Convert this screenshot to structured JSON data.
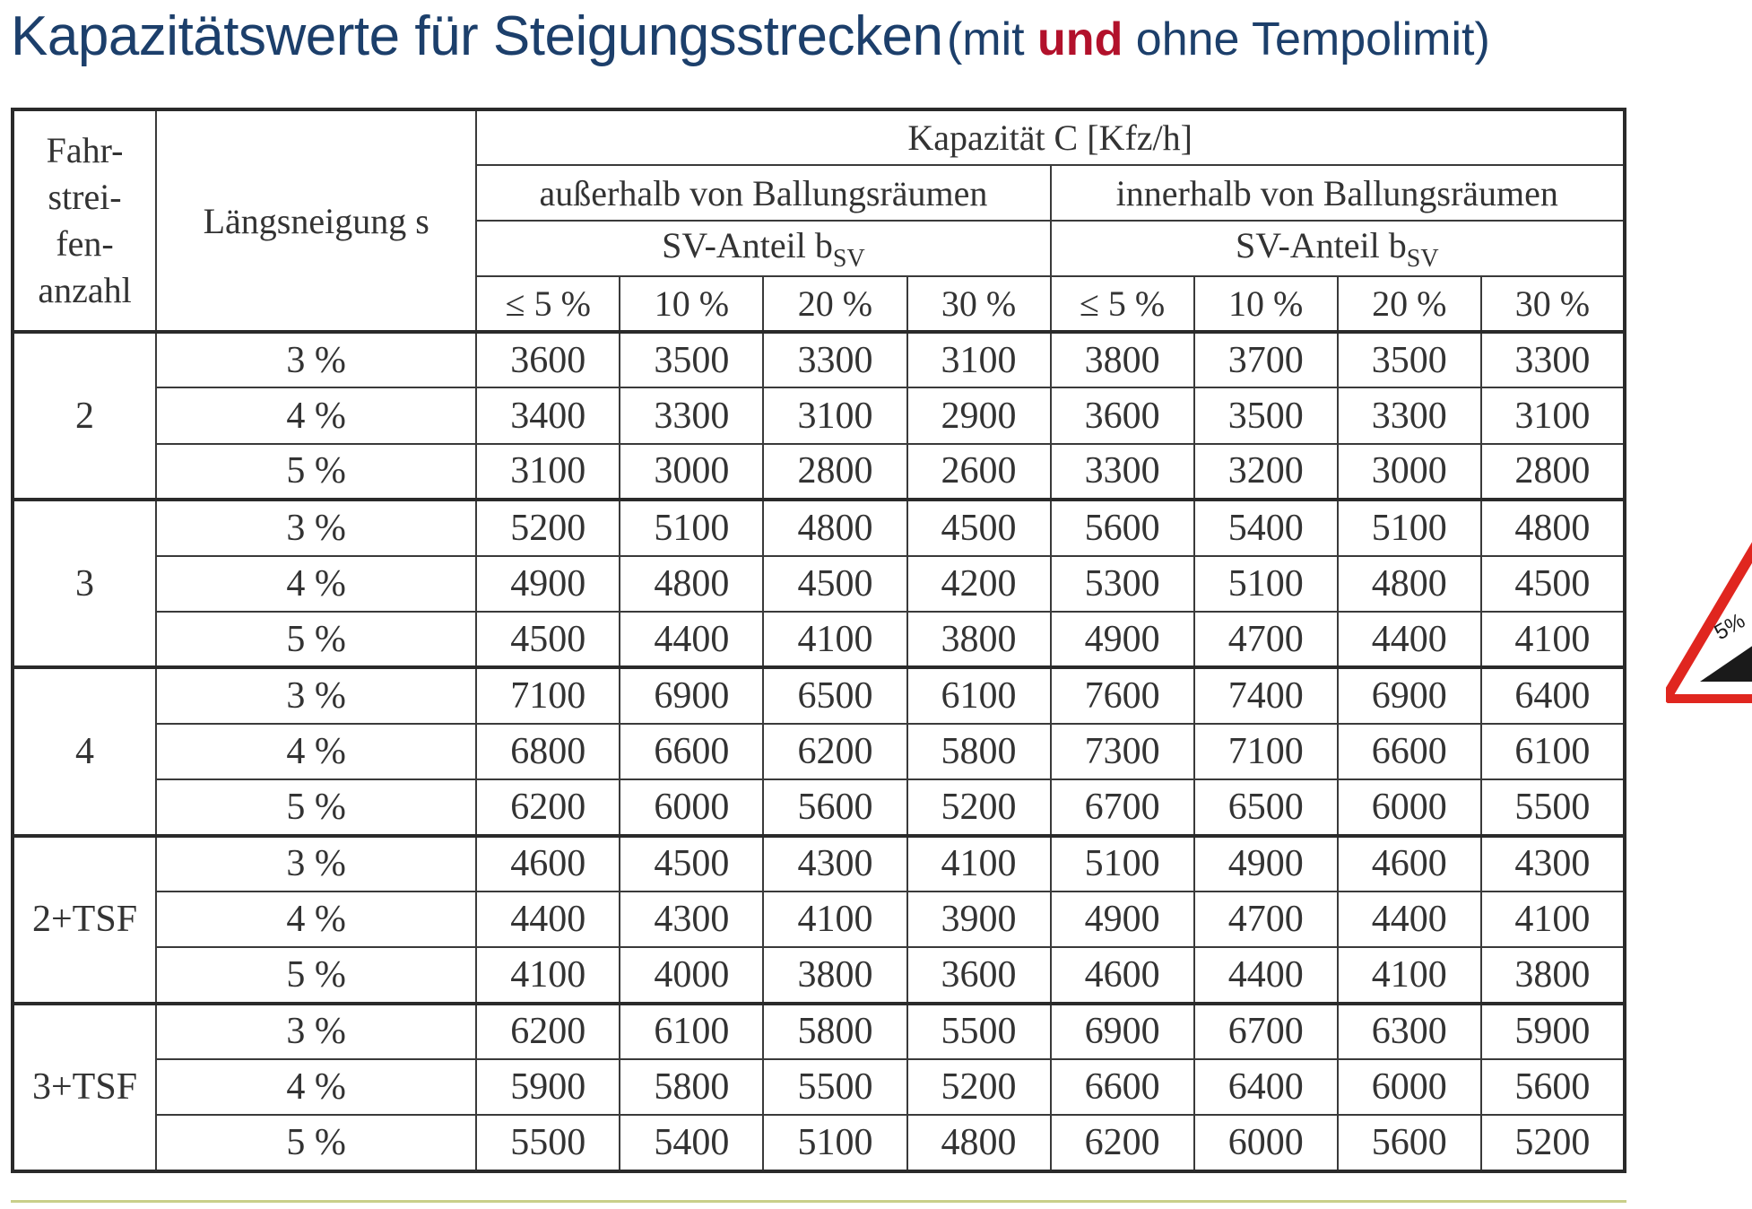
{
  "title": {
    "main": "Kapazitätswerte für Steigungsstrecken",
    "paren_open": "(mit ",
    "paren_accent": "und",
    "paren_rest": " ohne Tempolimit)",
    "color": "#1c3f6b",
    "accent_color": "#b2112b"
  },
  "table": {
    "header": {
      "lanes_label_lines": [
        "Fahr-",
        "strei-",
        "fen-",
        "anzahl"
      ],
      "slope_label": "Längsneigung s",
      "capacity_label": "Kapazität C [Kfz/h]",
      "groups": [
        "außerhalb von Ballungsräumen",
        "innerhalb von Ballungsräumen"
      ],
      "sv_label": "SV-Anteil b",
      "sv_subscript": "SV",
      "sv_columns": [
        "≤ 5 %",
        "10 %",
        "20 %",
        "30 %"
      ]
    },
    "groups": [
      {
        "lanes": "2",
        "rows": [
          {
            "slope": "3 %",
            "values": [
              "3600",
              "3500",
              "3300",
              "3100",
              "3800",
              "3700",
              "3500",
              "3300"
            ]
          },
          {
            "slope": "4 %",
            "values": [
              "3400",
              "3300",
              "3100",
              "2900",
              "3600",
              "3500",
              "3300",
              "3100"
            ]
          },
          {
            "slope": "5 %",
            "values": [
              "3100",
              "3000",
              "2800",
              "2600",
              "3300",
              "3200",
              "3000",
              "2800"
            ]
          }
        ]
      },
      {
        "lanes": "3",
        "rows": [
          {
            "slope": "3 %",
            "values": [
              "5200",
              "5100",
              "4800",
              "4500",
              "5600",
              "5400",
              "5100",
              "4800"
            ]
          },
          {
            "slope": "4 %",
            "values": [
              "4900",
              "4800",
              "4500",
              "4200",
              "5300",
              "5100",
              "4800",
              "4500"
            ]
          },
          {
            "slope": "5 %",
            "values": [
              "4500",
              "4400",
              "4100",
              "3800",
              "4900",
              "4700",
              "4400",
              "4100"
            ]
          }
        ]
      },
      {
        "lanes": "4",
        "rows": [
          {
            "slope": "3 %",
            "values": [
              "7100",
              "6900",
              "6500",
              "6100",
              "7600",
              "7400",
              "6900",
              "6400"
            ]
          },
          {
            "slope": "4 %",
            "values": [
              "6800",
              "6600",
              "6200",
              "5800",
              "7300",
              "7100",
              "6600",
              "6100"
            ]
          },
          {
            "slope": "5 %",
            "values": [
              "6200",
              "6000",
              "5600",
              "5200",
              "6700",
              "6500",
              "6000",
              "5500"
            ]
          }
        ]
      },
      {
        "lanes": "2+TSF",
        "rows": [
          {
            "slope": "3 %",
            "values": [
              "4600",
              "4500",
              "4300",
              "4100",
              "5100",
              "4900",
              "4600",
              "4300"
            ]
          },
          {
            "slope": "4 %",
            "values": [
              "4400",
              "4300",
              "4100",
              "3900",
              "4900",
              "4700",
              "4400",
              "4100"
            ]
          },
          {
            "slope": "5 %",
            "values": [
              "4100",
              "4000",
              "3800",
              "3600",
              "4600",
              "4400",
              "4100",
              "3800"
            ]
          }
        ]
      },
      {
        "lanes": "3+TSF",
        "rows": [
          {
            "slope": "3 %",
            "values": [
              "6200",
              "6100",
              "5800",
              "5500",
              "6900",
              "6700",
              "6300",
              "5900"
            ]
          },
          {
            "slope": "4 %",
            "values": [
              "5900",
              "5800",
              "5500",
              "5200",
              "6600",
              "6400",
              "6000",
              "5600"
            ]
          },
          {
            "slope": "5 %",
            "values": [
              "5500",
              "5400",
              "5100",
              "4800",
              "6200",
              "6000",
              "5600",
              "5200"
            ]
          }
        ]
      }
    ]
  },
  "sign": {
    "icon": "gradient-warning-sign-icon",
    "text": "5%",
    "border_color": "#e0261f"
  }
}
